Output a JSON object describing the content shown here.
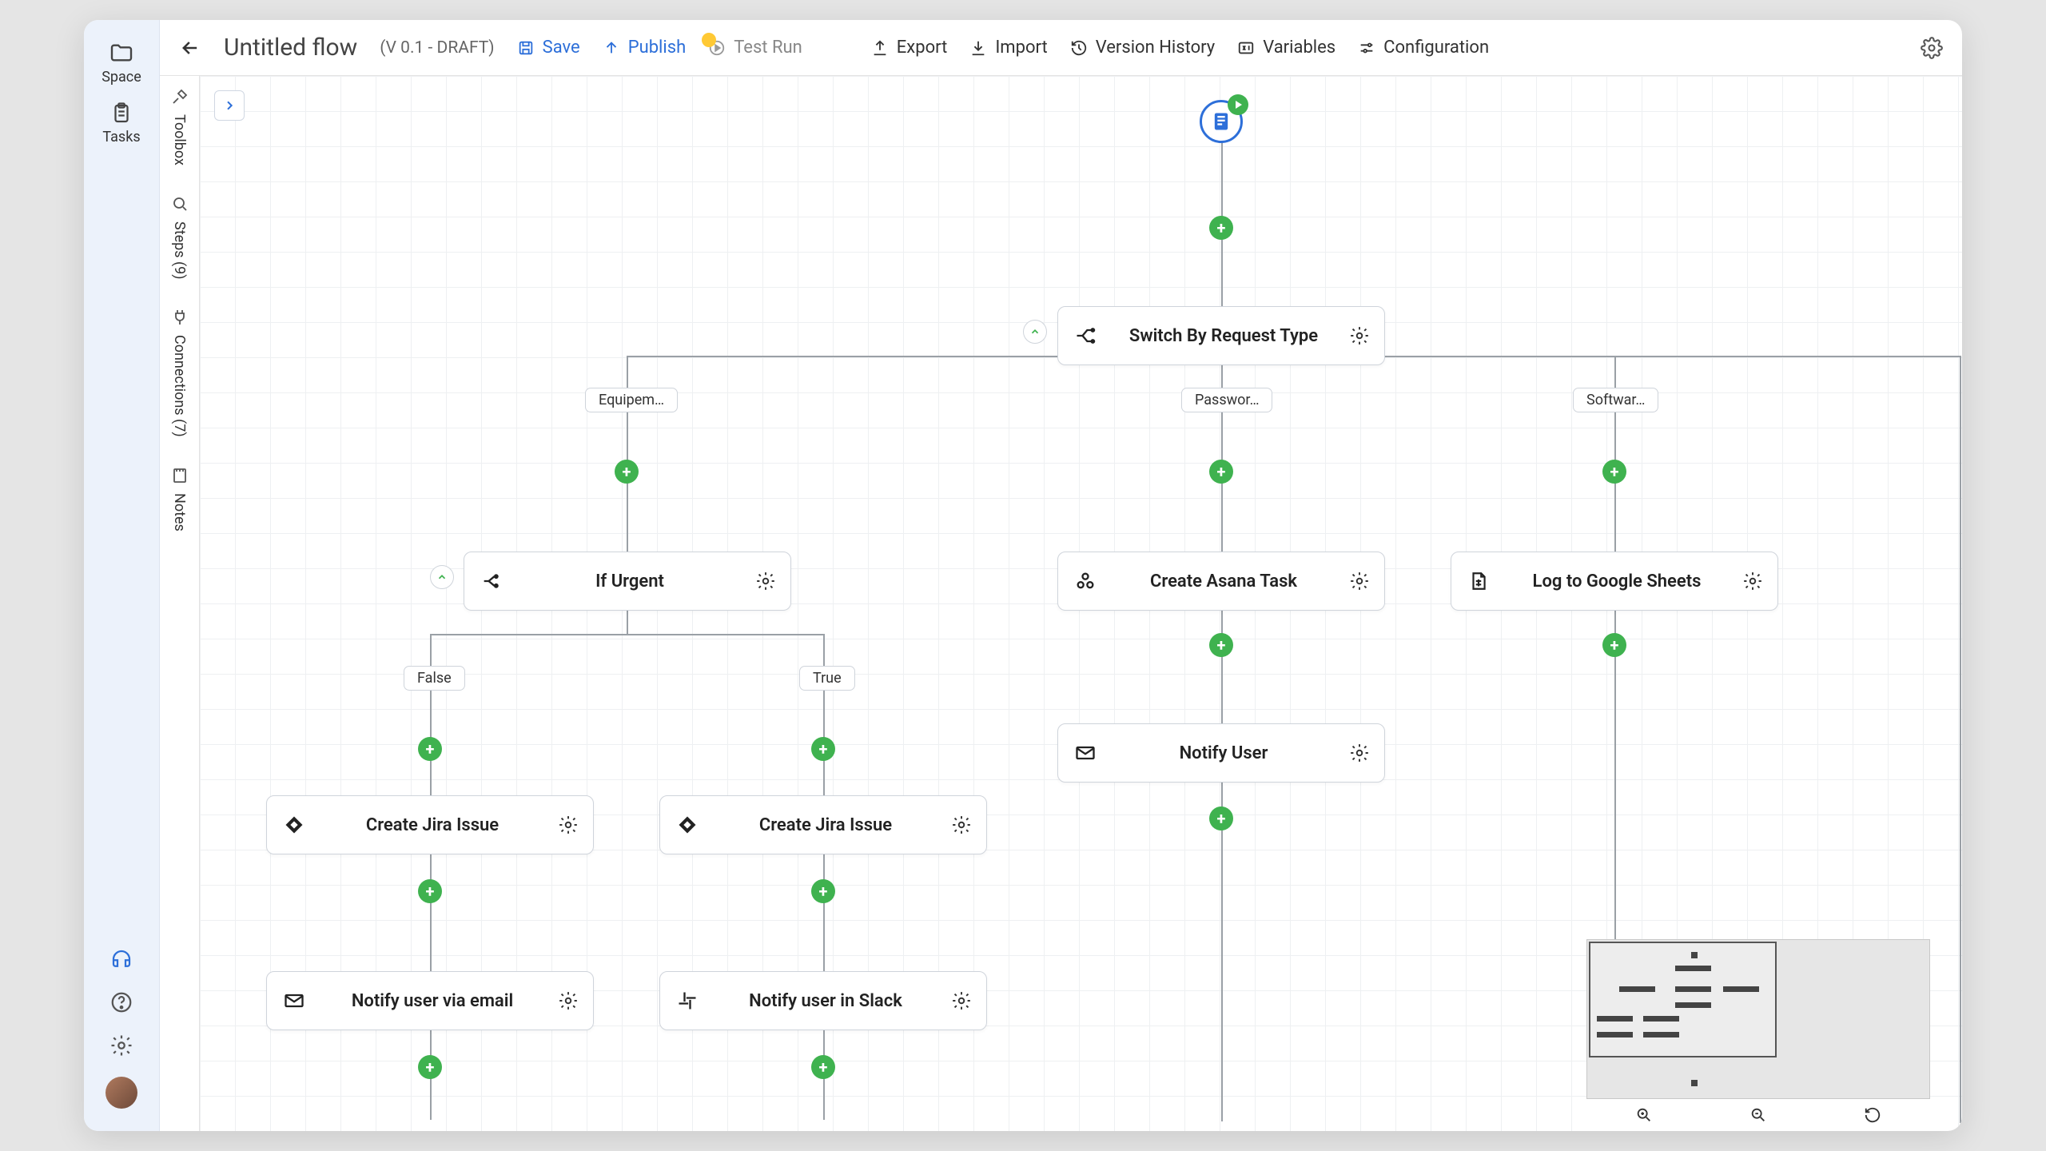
{
  "leftbar": {
    "space": "Space",
    "tasks": "Tasks"
  },
  "header": {
    "title": "Untitled flow",
    "version": "(V 0.1 - DRAFT)",
    "save": "Save",
    "publish": "Publish",
    "test_run": "Test Run",
    "export": "Export",
    "import": "Import",
    "version_history": "Version History",
    "variables": "Variables",
    "configuration": "Configuration"
  },
  "toolrail": {
    "toolbox": "Toolbox",
    "steps": "Steps (9)",
    "connections": "Connections (7)",
    "notes": "Notes"
  },
  "nodes": {
    "switch": "Switch By Request Type",
    "if_urgent": "If Urgent",
    "create_asana": "Create Asana Task",
    "log_sheets": "Log to Google Sheets",
    "jira_false": "Create Jira Issue",
    "jira_true": "Create Jira Issue",
    "notify_user": "Notify User",
    "notify_email": "Notify user via email",
    "notify_slack": "Notify user in Slack"
  },
  "branches": {
    "equip": "Equipem…",
    "password": "Passwor…",
    "software": "Softwar…",
    "false": "False",
    "true": "True"
  }
}
